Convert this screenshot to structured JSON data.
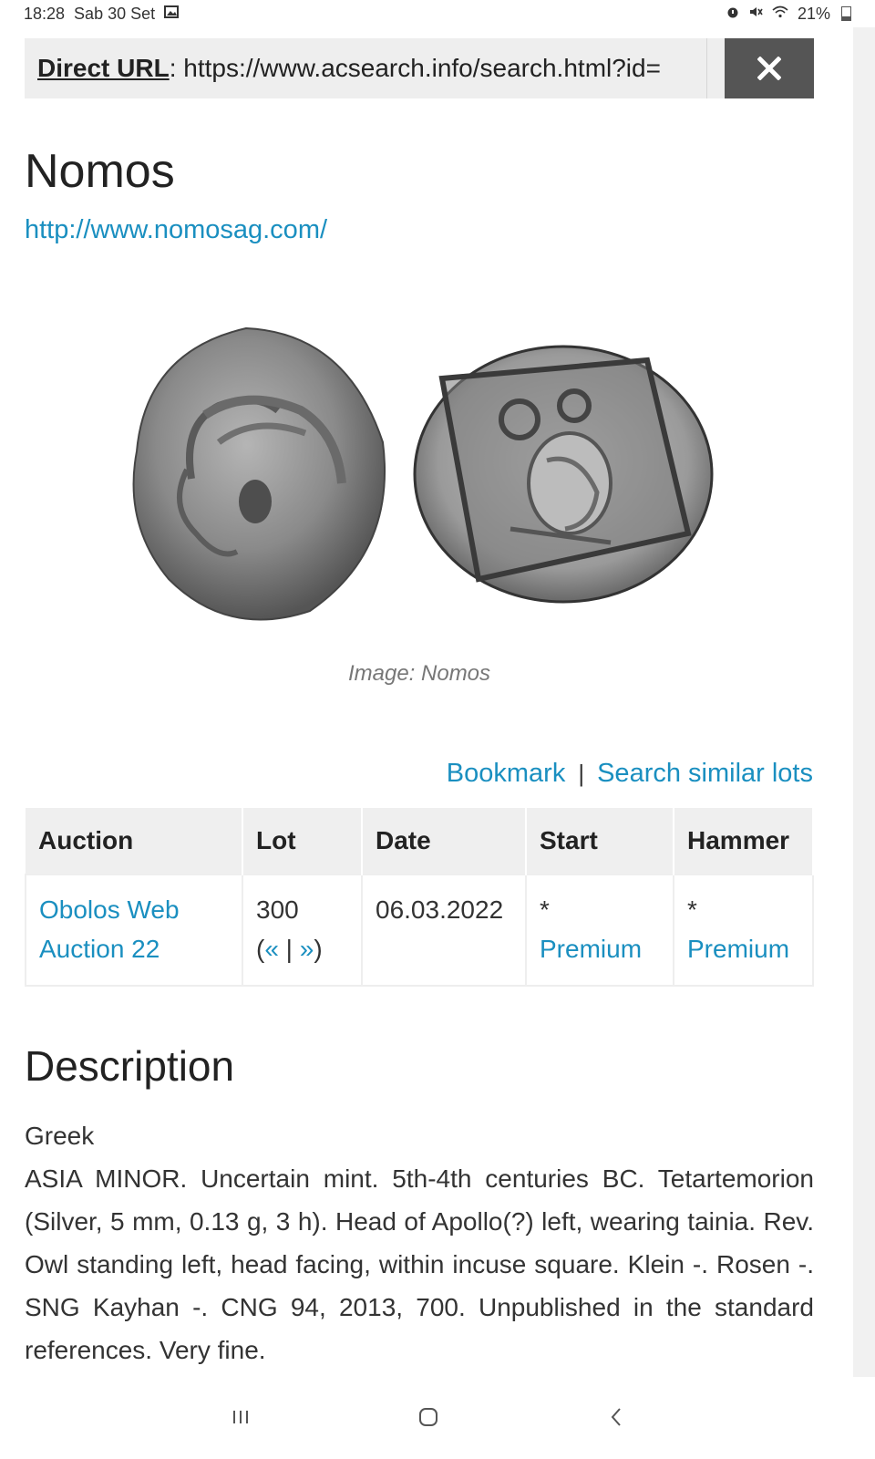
{
  "status": {
    "time": "18:28",
    "date": "Sab 30 Set",
    "battery": "21%"
  },
  "urlbar": {
    "label": "Direct URL",
    "url": ": https://www.acsearch.info/search.html?id="
  },
  "site": {
    "title": "Nomos",
    "link": "http://www.nomosag.com/"
  },
  "image": {
    "caption": "Image: Nomos"
  },
  "actions": {
    "bookmark": "Bookmark",
    "separator": "|",
    "search_similar": "Search similar lots"
  },
  "table": {
    "headers": [
      "Auction",
      "Lot",
      "Date",
      "Start",
      "Hammer"
    ],
    "row": {
      "auction": "Obolos Web Auction 22",
      "lot": "300",
      "lot_nav_prev": "«",
      "lot_nav_sep": " | ",
      "lot_nav_next": "»",
      "date": "06.03.2022",
      "start_mark": "*",
      "start_link": "Premium",
      "hammer_mark": "*",
      "hammer_link": "Premium"
    }
  },
  "description": {
    "title": "Description",
    "category": "Greek",
    "text": "ASIA MINOR. Uncertain mint. 5th-4th centuries BC. Tetartemorion (Silver, 5 mm, 0.13 g, 3 h). Head of Apollo(?) left, wearing tainia. Rev. Owl standing left, head facing, within incuse square. Klein -. Rosen -. SNG Kayhan -. CNG 94, 2013, 700. Unpublished in the standard references. Very fine."
  },
  "colors": {
    "link": "#1a8fc0",
    "close_button": "#555555",
    "header_bg": "#efefef"
  }
}
